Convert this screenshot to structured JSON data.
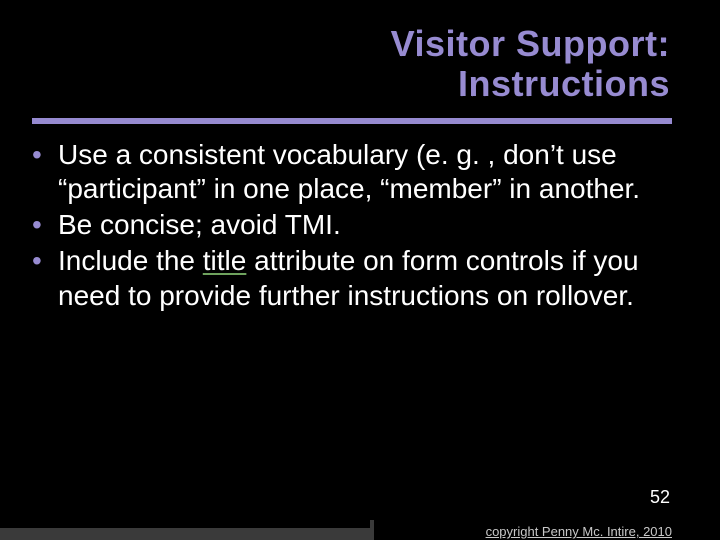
{
  "title": {
    "line1": "Visitor Support:",
    "line2": "Instructions"
  },
  "bullets": [
    {
      "pre": "Use a consistent vocabulary (e. g. , don’t use “participant” in one place, “member” in another.",
      "kw": "",
      "post": ""
    },
    {
      "pre": "Be concise; avoid TMI.",
      "kw": "",
      "post": ""
    },
    {
      "pre": "Include the ",
      "kw": "title",
      "post": " attribute on form controls if you need to provide further instructions on rollover."
    }
  ],
  "page_number": "52",
  "copyright": "copyright Penny Mc. Intire, 2010"
}
